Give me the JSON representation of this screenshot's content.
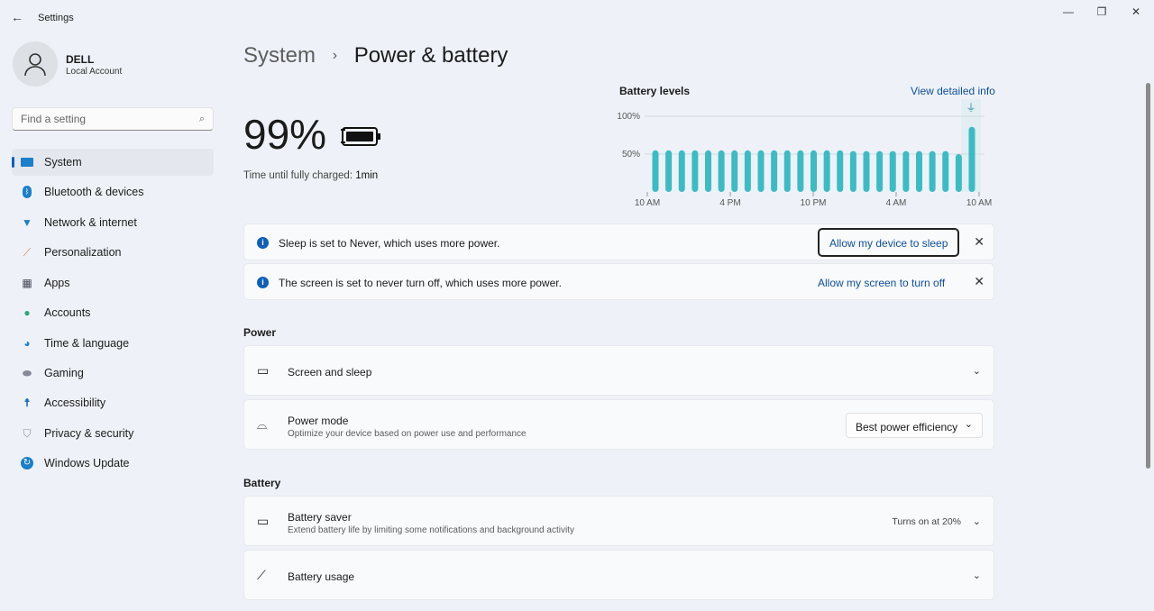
{
  "window": {
    "title": "Settings"
  },
  "user": {
    "name": "DELL",
    "account": "Local Account"
  },
  "search": {
    "placeholder": "Find a setting"
  },
  "sidebar": {
    "items": [
      {
        "label": "System",
        "icon": "monitor-icon",
        "active": true
      },
      {
        "label": "Bluetooth & devices",
        "icon": "bluetooth-icon"
      },
      {
        "label": "Network & internet",
        "icon": "wifi-icon"
      },
      {
        "label": "Personalization",
        "icon": "brush-icon"
      },
      {
        "label": "Apps",
        "icon": "apps-icon"
      },
      {
        "label": "Accounts",
        "icon": "person-icon"
      },
      {
        "label": "Time & language",
        "icon": "globe-clock-icon"
      },
      {
        "label": "Gaming",
        "icon": "gamepad-icon"
      },
      {
        "label": "Accessibility",
        "icon": "accessibility-icon"
      },
      {
        "label": "Privacy & security",
        "icon": "shield-icon"
      },
      {
        "label": "Windows Update",
        "icon": "update-icon"
      }
    ]
  },
  "breadcrumb": {
    "parent": "System",
    "sep": "›",
    "current": "Power & battery"
  },
  "battery": {
    "percent": "99%",
    "charge_label": "Time until fully charged:",
    "charge_value": "1min"
  },
  "chart": {
    "title": "Battery levels",
    "link": "View detailed info",
    "plug_icon": "plug-icon",
    "bar_color": "#3bbcc4"
  },
  "chart_data": {
    "type": "bar",
    "title": "Battery levels",
    "y_ticks": [
      "100%",
      "50%"
    ],
    "x_ticks": [
      "10 AM",
      "4 PM",
      "10 PM",
      "4 AM",
      "10 AM"
    ],
    "ylim": [
      0,
      100
    ],
    "values": [
      55,
      55,
      55,
      55,
      55,
      55,
      55,
      55,
      55,
      55,
      55,
      55,
      55,
      55,
      55,
      54,
      54,
      54,
      54,
      54,
      54,
      54,
      54,
      50,
      86
    ]
  },
  "notices": [
    {
      "text": "Sleep is set to Never, which uses more power.",
      "action": "Allow my device to sleep"
    },
    {
      "text": "The screen is set to never turn off, which uses more power.",
      "action": "Allow my screen to turn off"
    }
  ],
  "power": {
    "section": "Power",
    "screen_sleep": "Screen and sleep",
    "mode_title": "Power mode",
    "mode_sub": "Optimize your device based on power use and performance",
    "mode_value": "Best power efficiency"
  },
  "batterySection": {
    "section": "Battery",
    "saver_title": "Battery saver",
    "saver_sub": "Extend battery life by limiting some notifications and background activity",
    "saver_value": "Turns on at 20%",
    "usage": "Battery usage"
  }
}
